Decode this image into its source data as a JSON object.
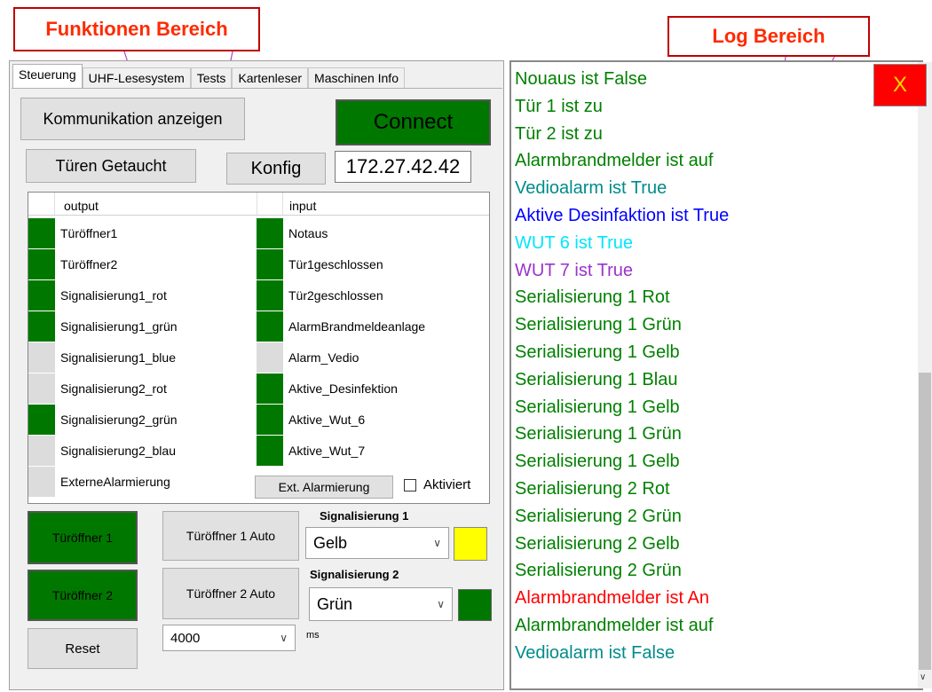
{
  "callouts": {
    "functions": "Funktionen Bereich",
    "log": "Log Bereich"
  },
  "tabs": [
    "Steuerung",
    "UHF-Lesesystem",
    "Tests",
    "Kartenleser",
    "Maschinen Info"
  ],
  "buttons": {
    "kommunikation": "Kommunikation anzeigen",
    "connect": "Connect",
    "tueren_getaucht": "Türen Getaucht",
    "konfig": "Konfig",
    "ext_alarmierung": "Ext. Alarmierung",
    "tueroeffner1": "Türöffner 1",
    "tueroeffner1_auto": "Türöffner 1 Auto",
    "tueroeffner2": "Türöffner 2",
    "tueroeffner2_auto": "Türöffner 2 Auto",
    "reset": "Reset",
    "close": "X"
  },
  "ip_address": "172.27.42.42",
  "output_header": "output",
  "input_header": "input",
  "outputs": [
    {
      "label": "Türöffner1",
      "on": true
    },
    {
      "label": "Türöffner2",
      "on": true
    },
    {
      "label": "Signalisierung1_rot",
      "on": true
    },
    {
      "label": "Signalisierung1_grün",
      "on": true
    },
    {
      "label": "Signalisierung1_blue",
      "on": false
    },
    {
      "label": "Signalisierung2_rot",
      "on": false
    },
    {
      "label": "Signalisierung2_grün",
      "on": true
    },
    {
      "label": "Signalisierung2_blau",
      "on": false
    },
    {
      "label": "ExterneAlarmierung",
      "on": false
    }
  ],
  "inputs": [
    {
      "label": "Notaus",
      "on": true
    },
    {
      "label": "Tür1geschlossen",
      "on": true
    },
    {
      "label": "Tür2geschlossen",
      "on": true
    },
    {
      "label": "AlarmBrandmeldeanlage",
      "on": true
    },
    {
      "label": "Alarm_Vedio",
      "on": false
    },
    {
      "label": "Aktive_Desinfektion",
      "on": true
    },
    {
      "label": "Aktive_Wut_6",
      "on": true
    },
    {
      "label": "Aktive_Wut_7",
      "on": true
    }
  ],
  "aktiviert": {
    "label": "Aktiviert",
    "checked": false
  },
  "signal1": {
    "label": "Signalisierung 1",
    "value": "Gelb",
    "swatch": "#ffff00"
  },
  "signal2": {
    "label": "Signalisierung 2",
    "value": "Grün",
    "swatch": "#007800"
  },
  "delay": {
    "value": "4000",
    "unit": "ms"
  },
  "log": [
    {
      "text": "Nouaus ist False",
      "color": "#008000"
    },
    {
      "text": "Tür 1  ist zu",
      "color": "#008000"
    },
    {
      "text": "Tür 2  ist zu",
      "color": "#008000"
    },
    {
      "text": "Alarmbrandmelder ist auf",
      "color": "#008000"
    },
    {
      "text": "Vedioalarm ist True",
      "color": "#008b8b"
    },
    {
      "text": "Aktive Desinfaktion ist True",
      "color": "#0000ff"
    },
    {
      "text": "WUT 6 ist True",
      "color": "#00e5ff"
    },
    {
      "text": "WUT 7  ist True",
      "color": "#9a32cd"
    },
    {
      "text": "Serialisierung 1 Rot",
      "color": "#008000"
    },
    {
      "text": "Serialisierung 1 Grün",
      "color": "#008000"
    },
    {
      "text": "Serialisierung 1 Gelb",
      "color": "#008000"
    },
    {
      "text": "Serialisierung 1 Blau",
      "color": "#008000"
    },
    {
      "text": "Serialisierung 1 Gelb",
      "color": "#008000"
    },
    {
      "text": "Serialisierung 1 Grün",
      "color": "#008000"
    },
    {
      "text": "Serialisierung 1 Gelb",
      "color": "#008000"
    },
    {
      "text": "Serialisierung 2 Rot",
      "color": "#008000"
    },
    {
      "text": "Serialisierung 2 Grün",
      "color": "#008000"
    },
    {
      "text": "Serialisierung 2 Gelb",
      "color": "#008000"
    },
    {
      "text": "Serialisierung 2 Grün",
      "color": "#008000"
    },
    {
      "text": "Alarmbrandmelder ist An",
      "color": "#ff0000"
    },
    {
      "text": "Alarmbrandmelder ist auf",
      "color": "#008000"
    },
    {
      "text": "Vedioalarm ist False",
      "color": "#008b8b"
    }
  ]
}
